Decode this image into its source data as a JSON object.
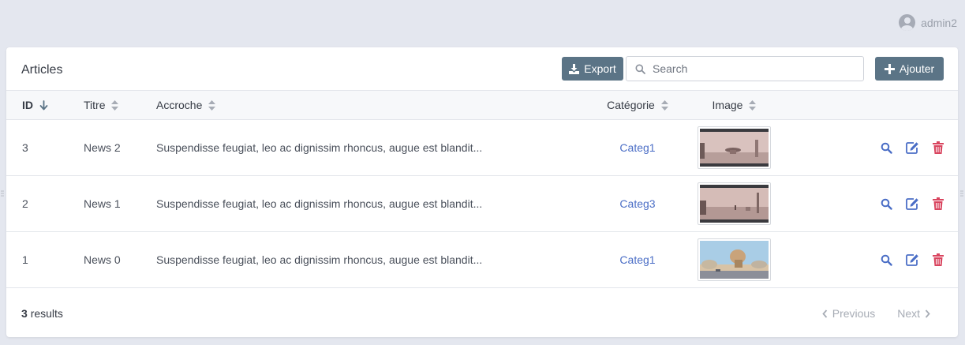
{
  "user": {
    "name": "admin2"
  },
  "card": {
    "title": "Articles",
    "export_label": "Export",
    "add_label": "Ajouter",
    "search_placeholder": "Search"
  },
  "table": {
    "columns": [
      "ID",
      "Titre",
      "Accroche",
      "Catégorie",
      "Image"
    ],
    "sort": {
      "column": "ID",
      "direction": "desc"
    },
    "rows": [
      {
        "id": "3",
        "title": "News 2",
        "excerpt": "Suspendisse feugiat, leo ac dignissim rhoncus, augue est blandit...",
        "category": "Categ1",
        "image": "pink-misty-landscape"
      },
      {
        "id": "2",
        "title": "News 1",
        "excerpt": "Suspendisse feugiat, leo ac dignissim rhoncus, augue est blandit...",
        "category": "Categ3",
        "image": "pink-misty-landscape"
      },
      {
        "id": "1",
        "title": "News 0",
        "excerpt": "Suspendisse feugiat, leo ac dignissim rhoncus, augue est blandit...",
        "category": "Categ1",
        "image": "blue-sky-landscape"
      }
    ],
    "row_actions": [
      "show-icon",
      "edit-icon",
      "delete-icon"
    ]
  },
  "footer": {
    "count": "3",
    "results_label": "results",
    "previous_label": "Previous",
    "next_label": "Next"
  },
  "colors": {
    "page_bg": "#e4e7ef",
    "button": "#5b7486",
    "link": "#4b6ec6",
    "delete": "#d9455f",
    "disabled": "#a7acb5"
  }
}
